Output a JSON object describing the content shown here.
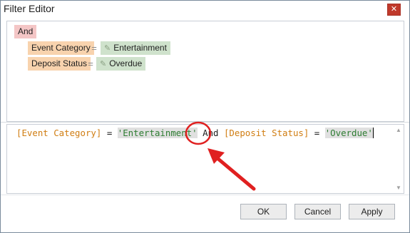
{
  "window": {
    "title": "Filter Editor",
    "close_glyph": "✕"
  },
  "tree": {
    "operator": "And",
    "conditions": [
      {
        "field": "Event Category",
        "operator": "=",
        "value": "Entertainment"
      },
      {
        "field": "Deposit Status",
        "operator": "=",
        "value": "Overdue"
      }
    ],
    "edit_icon": "pencil-icon"
  },
  "expression": {
    "field1": "[Event Category]",
    "op1": " = ",
    "value1": "'Entertainment'",
    "joiner": " And ",
    "field2": "[Deposit Status]",
    "op2": " = ",
    "value2": "'Overdue'"
  },
  "buttons": {
    "ok": "OK",
    "cancel": "Cancel",
    "apply": "Apply"
  },
  "colors": {
    "operator_chip": "#f4c6c6",
    "field_chip": "#f8d3ae",
    "value_chip": "#cfe2cc",
    "field_text": "#d07d12",
    "string_text": "#2e7d32",
    "annotation": "#e02020"
  }
}
